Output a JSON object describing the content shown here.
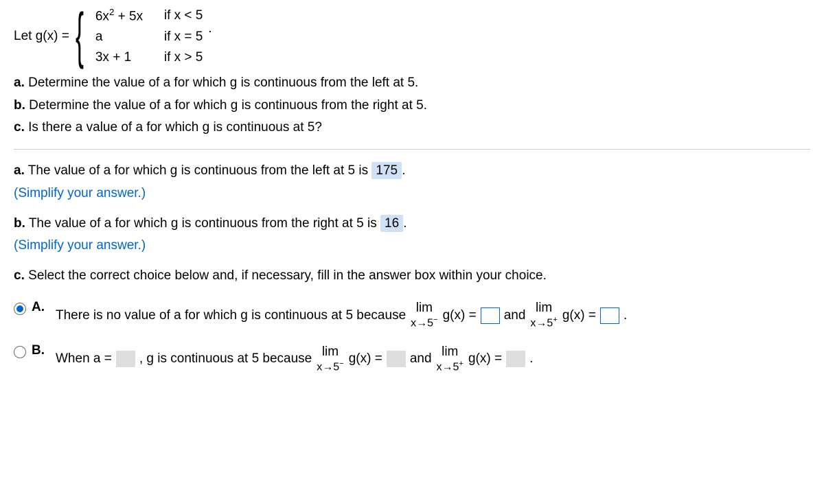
{
  "header": {
    "let": "Let g(x) =",
    "pieces": [
      {
        "expr_a": "6x",
        "expr_sup": "2",
        "expr_b": " + 5x",
        "cond": "if x < 5"
      },
      {
        "expr": "a",
        "cond": "if x = 5"
      },
      {
        "expr": "3x + 1",
        "cond": "if x > 5"
      }
    ],
    "dot": "."
  },
  "questions": {
    "a": "Determine the value of a for which g is continuous from the left at 5.",
    "b": "Determine the value of a for which g is continuous from the right at 5.",
    "c": "Is there a value of a for which g is continuous at 5?"
  },
  "partA": {
    "prefix": "The value of a for which g is continuous from the left at 5 is",
    "answer": "175",
    "suffix": ".",
    "hint": "(Simplify your answer.)"
  },
  "partB": {
    "prefix": "The value of a for which g is continuous from the right at 5 is",
    "answer": "16",
    "suffix": ".",
    "hint": "(Simplify your answer.)"
  },
  "partC": {
    "prompt": "Select the correct choice below and, if necessary, fill in the answer box within your choice.",
    "choiceA": {
      "label": "A.",
      "t1": "There is no value of a for which g is continuous at 5 because",
      "lim": "lim",
      "gx_eq": "g(x) =",
      "arrow_minus": "x→5",
      "minus": "−",
      "and": "and",
      "arrow_plus": "x→5",
      "plus": "+",
      "dot": "."
    },
    "choiceB": {
      "label": "B.",
      "t1": "When a =",
      "t2": ", g is continuous at 5 because",
      "lim": "lim",
      "gx_eq": "g(x) =",
      "arrow_minus": "x→5",
      "minus": "−",
      "and": "and",
      "arrow_plus": "x→5",
      "plus": "+",
      "dot": "."
    }
  },
  "labels": {
    "a": "a.",
    "b": "b.",
    "c": "c."
  }
}
